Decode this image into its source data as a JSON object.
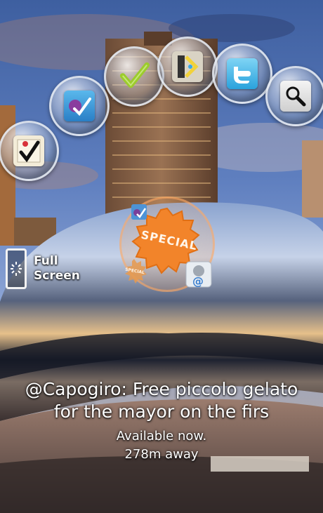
{
  "launcher": {
    "items": [
      {
        "name": "checklist-app",
        "icon": "checklist-note-icon"
      },
      {
        "name": "foursquare-app",
        "icon": "foursquare-check-icon"
      },
      {
        "name": "checkins-app",
        "icon": "green-check-icon"
      },
      {
        "name": "gowalla-app",
        "icon": "arrow-tile-icon"
      },
      {
        "name": "twitter-app",
        "icon": "twitter-bird-icon"
      },
      {
        "name": "search-app",
        "icon": "search-icon"
      }
    ]
  },
  "fullscreen": {
    "line1": "Full",
    "line2": "Screen",
    "icon": "phone-icon"
  },
  "special_marker": {
    "badge_text": "SPECIAL",
    "small_badge_text": "SPECIAL",
    "accent": "#f2842a"
  },
  "poi": {
    "title": "@Capogiro: Free piccolo gelato for the mayor on the firs",
    "availability": "Available now.",
    "distance": "278m away"
  }
}
